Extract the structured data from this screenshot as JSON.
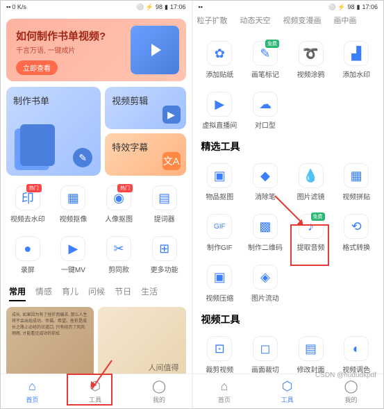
{
  "status": {
    "speed": "0 K/s",
    "bt": "⚪",
    "batt": "98",
    "time": "17:06"
  },
  "left": {
    "banner": {
      "title": "如何制作书单视频?",
      "sub": "千言万语, 一键成片",
      "btn": "立即查看"
    },
    "cards": {
      "c1": "制作书单",
      "c2": "视频剪辑",
      "c3": "特效字幕"
    },
    "row1": [
      {
        "label": "视频去水印",
        "badge": "热门",
        "icon": "印"
      },
      {
        "label": "视频抠像",
        "icon": "▦"
      },
      {
        "label": "人像抠图",
        "badge": "热门",
        "icon": "◉"
      },
      {
        "label": "提词器",
        "icon": "▤"
      }
    ],
    "row2": [
      {
        "label": "录屏",
        "icon": "●"
      },
      {
        "label": "一键MV",
        "icon": "▶"
      },
      {
        "label": "剪同款",
        "icon": "✂"
      },
      {
        "label": "更多功能",
        "icon": "⊞"
      }
    ],
    "tabs": [
      "常用",
      "情感",
      "育儿",
      "问候",
      "节日",
      "生活"
    ],
    "feed1_text": "成长, 如果因为有了挫折而痛苦, 那么人生将不会出现成功、幸福、希望。挫折是成长之路上必经的岔道口, 只有经历了风风雨雨, 才能看见成功的彩虹",
    "feed2_text": "人间值得",
    "nav": [
      "首页",
      "工具",
      "我的"
    ]
  },
  "right": {
    "cat_tabs": [
      "粒子扩散",
      "动态天空",
      "视频变漫画",
      "画中画"
    ],
    "sec0": [
      {
        "label": "添加贴纸",
        "icon": "✿"
      },
      {
        "label": "画笔标记",
        "icon": "✎",
        "badge": "免费"
      },
      {
        "label": "视频涂鸦",
        "icon": "➰"
      },
      {
        "label": "添加水印",
        "icon": "▟"
      }
    ],
    "sec0b": [
      {
        "label": "虚拟直播间",
        "icon": "▶"
      },
      {
        "label": "对口型",
        "icon": "☁"
      }
    ],
    "sec1_title": "精选工具",
    "sec1": [
      {
        "label": "物品抠图",
        "icon": "▣"
      },
      {
        "label": "消除笔",
        "icon": "◆"
      },
      {
        "label": "图片滤镜",
        "icon": "💧"
      },
      {
        "label": "视频拼贴",
        "icon": "▦"
      }
    ],
    "sec1b": [
      {
        "label": "制作GIF",
        "icon": "GIF"
      },
      {
        "label": "制作二维码",
        "icon": "▩"
      },
      {
        "label": "提取音频",
        "icon": "♪",
        "badge": "免费"
      },
      {
        "label": "格式转换",
        "icon": "⟲"
      }
    ],
    "sec1c": [
      {
        "label": "视频压缩",
        "icon": "▣"
      },
      {
        "label": "图片流动",
        "icon": "◈"
      }
    ],
    "sec2_title": "视频工具",
    "sec2": [
      {
        "label": "裁剪视频",
        "icon": "⊡"
      },
      {
        "label": "画面裁切",
        "icon": "◻"
      },
      {
        "label": "修改封面",
        "icon": "▤"
      },
      {
        "label": "视频调色",
        "icon": "◐"
      }
    ],
    "nav": [
      "首页",
      "工具",
      "我的"
    ]
  },
  "watermark": "CSDN @hududkpdf"
}
